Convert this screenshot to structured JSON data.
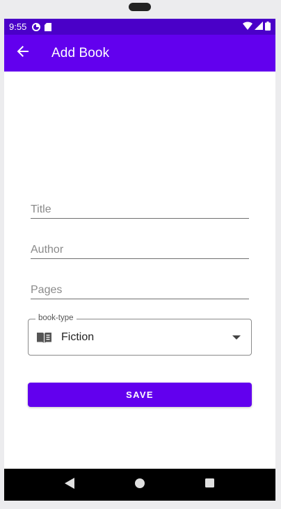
{
  "status_bar": {
    "time": "9:55",
    "icons": [
      "data-saver-icon",
      "sd-card-icon",
      "wifi-icon",
      "signal-icon",
      "battery-icon"
    ]
  },
  "app_bar": {
    "title": "Add Book",
    "back_icon": "arrow-back-icon"
  },
  "form": {
    "title_placeholder": "Title",
    "title_value": "",
    "author_placeholder": "Author",
    "author_value": "",
    "pages_placeholder": "Pages",
    "pages_value": "",
    "book_type": {
      "label": "book-type",
      "value": "Fiction",
      "icon": "book-icon"
    },
    "save_label": "SAVE"
  },
  "nav_bar": {
    "buttons": [
      "back-triangle-icon",
      "home-circle-icon",
      "recents-square-icon"
    ]
  },
  "colors": {
    "status_bar": "#4a00c8",
    "primary": "#6200ee",
    "nav_bar": "#000000"
  }
}
